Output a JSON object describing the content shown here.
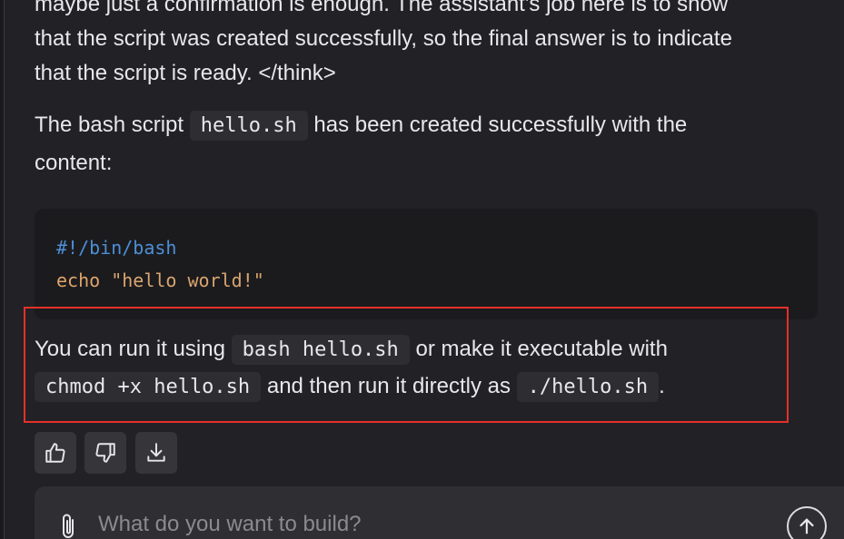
{
  "message": {
    "think_tail_line1": "maybe just a confirmation is enough. The assistant's job here is to show",
    "think_tail_line2": "that the script was created successfully, so the final answer is to indicate",
    "think_tail_line3": "that the script is ready. </think>",
    "summary_pre": "The bash script ",
    "summary_code": "hello.sh",
    "summary_post": " has been created successfully with the",
    "summary_line2": "content:",
    "code_lines": {
      "line1": "#!/bin/bash",
      "line2_cmd": "echo",
      "line2_str": "\"hello world!\""
    },
    "run_pre": "You can run it using ",
    "run_code1": "bash hello.sh",
    "run_mid": " or make it executable with",
    "run_code2": "chmod +x hello.sh",
    "run_mid2": " and then run it directly as ",
    "run_code3": "./hello.sh",
    "run_end": "."
  },
  "actions": {
    "like_icon": "thumbs-up-icon",
    "dislike_icon": "thumbs-down-icon",
    "download_icon": "download-icon"
  },
  "composer": {
    "placeholder": "What do you want to build?",
    "attach_icon": "paperclip-icon",
    "send_icon": "arrow-up-icon"
  },
  "colors": {
    "background": "#222226",
    "highlight": "#e5302a",
    "code_comment": "#4d8fd6",
    "code_string": "#d9a56f"
  }
}
